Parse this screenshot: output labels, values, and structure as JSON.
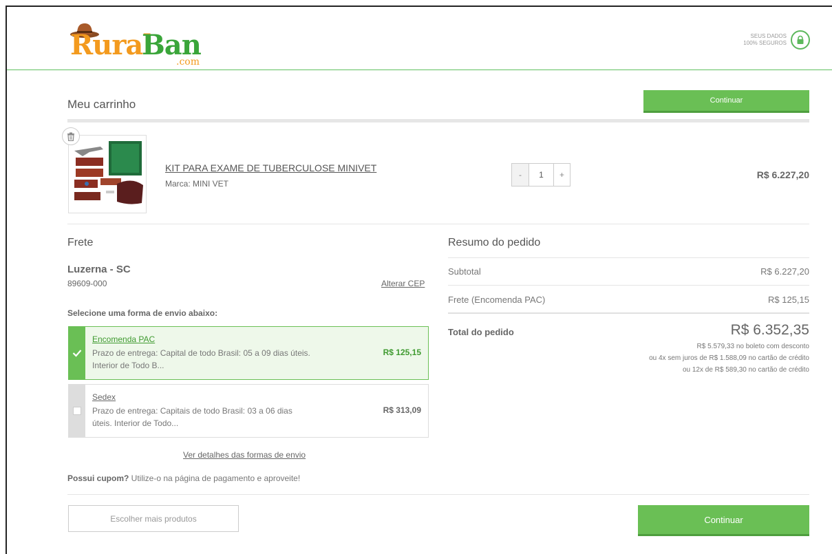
{
  "header": {
    "logo_rural": "Rural",
    "logo_ban": "Ban",
    "logo_com": ".com",
    "secure_line1": "SEUS DADOS",
    "secure_line2": "100% SEGUROS"
  },
  "cart": {
    "title": "Meu carrinho",
    "continue_label": "Continuar"
  },
  "product": {
    "name": "KIT PARA EXAME DE TUBERCULOSE MINIVET",
    "brand": "Marca: MINI VET",
    "quantity": "1",
    "minus": "-",
    "plus": "+",
    "price": "R$ 6.227,20"
  },
  "frete": {
    "title": "Frete",
    "city": "Luzerna - SC",
    "cep": "89609-000",
    "change_cep": "Alterar CEP",
    "select_label": "Selecione uma forma de envio abaixo:",
    "options": [
      {
        "name": "Encomenda PAC",
        "desc": "Prazo de entrega: Capital de todo Brasil: 05 a 09 dias úteis. Interior de Todo B...",
        "price": "R$ 125,15",
        "selected": true
      },
      {
        "name": "Sedex",
        "desc": "Prazo de entrega: Capitais de todo Brasil: 03 a 06 dias úteis. Interior de Todo...",
        "price": "R$ 313,09",
        "selected": false
      }
    ],
    "details_link": "Ver detalhes das formas de envio",
    "coupon_bold": "Possui cupom?",
    "coupon_text": " Utilize-o na página de pagamento e aproveite!"
  },
  "summary": {
    "title": "Resumo do pedido",
    "subtotal_label": "Subtotal",
    "subtotal_value": "R$ 6.227,20",
    "frete_label": "Frete (Encomenda PAC)",
    "frete_value": "R$ 125,15",
    "total_label": "Total do pedido",
    "total_value": "R$ 6.352,35",
    "boleto": "R$ 5.579,33 no boleto com desconto",
    "installments4": "ou 4x sem juros de R$ 1.588,09 no cartão de crédito",
    "installments12": "ou 12x de R$ 589,30 no cartão de crédito"
  },
  "footer": {
    "more_products": "Escolher mais produtos",
    "continue_label": "Continuar"
  },
  "colors": {
    "accent": "#6abf55",
    "logo_orange": "#f39a1e",
    "logo_green": "#3aa53a"
  }
}
